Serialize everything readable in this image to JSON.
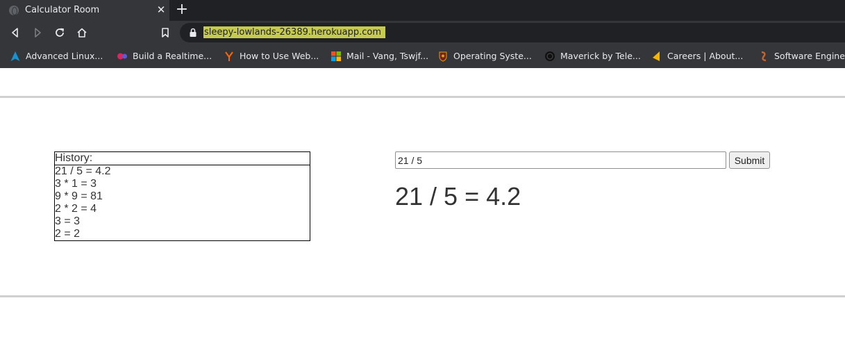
{
  "browser": {
    "tab": {
      "title": "Calculator Room",
      "close": "✕"
    },
    "new_tab": "+",
    "url": "sleepy-lowlands-26389.herokuapp.com",
    "bookmarks": [
      {
        "label": "Advanced Linux...",
        "icon": "arch-linux-icon",
        "color": "#1793d1"
      },
      {
        "label": "Build a Realtime...",
        "icon": "build-realtime-icon",
        "color": "#e0245e"
      },
      {
        "label": "How to Use Web...",
        "icon": "ycombinator-icon",
        "color": "#ff6600"
      },
      {
        "label": "Mail - Vang, Tswjf...",
        "icon": "microsoft-icon",
        "color": "#00a4ef"
      },
      {
        "label": "Operating Syste...",
        "icon": "university-crest-icon",
        "color": "#a0522d"
      },
      {
        "label": "Maverick by Tele...",
        "icon": "maverick-icon",
        "color": "#111111"
      },
      {
        "label": "Careers | About...",
        "icon": "careers-icon",
        "color": "#f4b400"
      },
      {
        "label": "Software Enginee...",
        "icon": "software-engineer-icon",
        "color": "#c8642b"
      }
    ]
  },
  "history": {
    "title": "History:",
    "items": [
      "21 / 5 = 4.2",
      "3 * 1 = 3",
      "9 * 9 = 81",
      "2 * 2 = 4",
      "3 = 3",
      "2 = 2"
    ]
  },
  "calculator": {
    "input_value": "21 / 5",
    "submit_label": "Submit",
    "result": "21 / 5 = 4.2"
  }
}
